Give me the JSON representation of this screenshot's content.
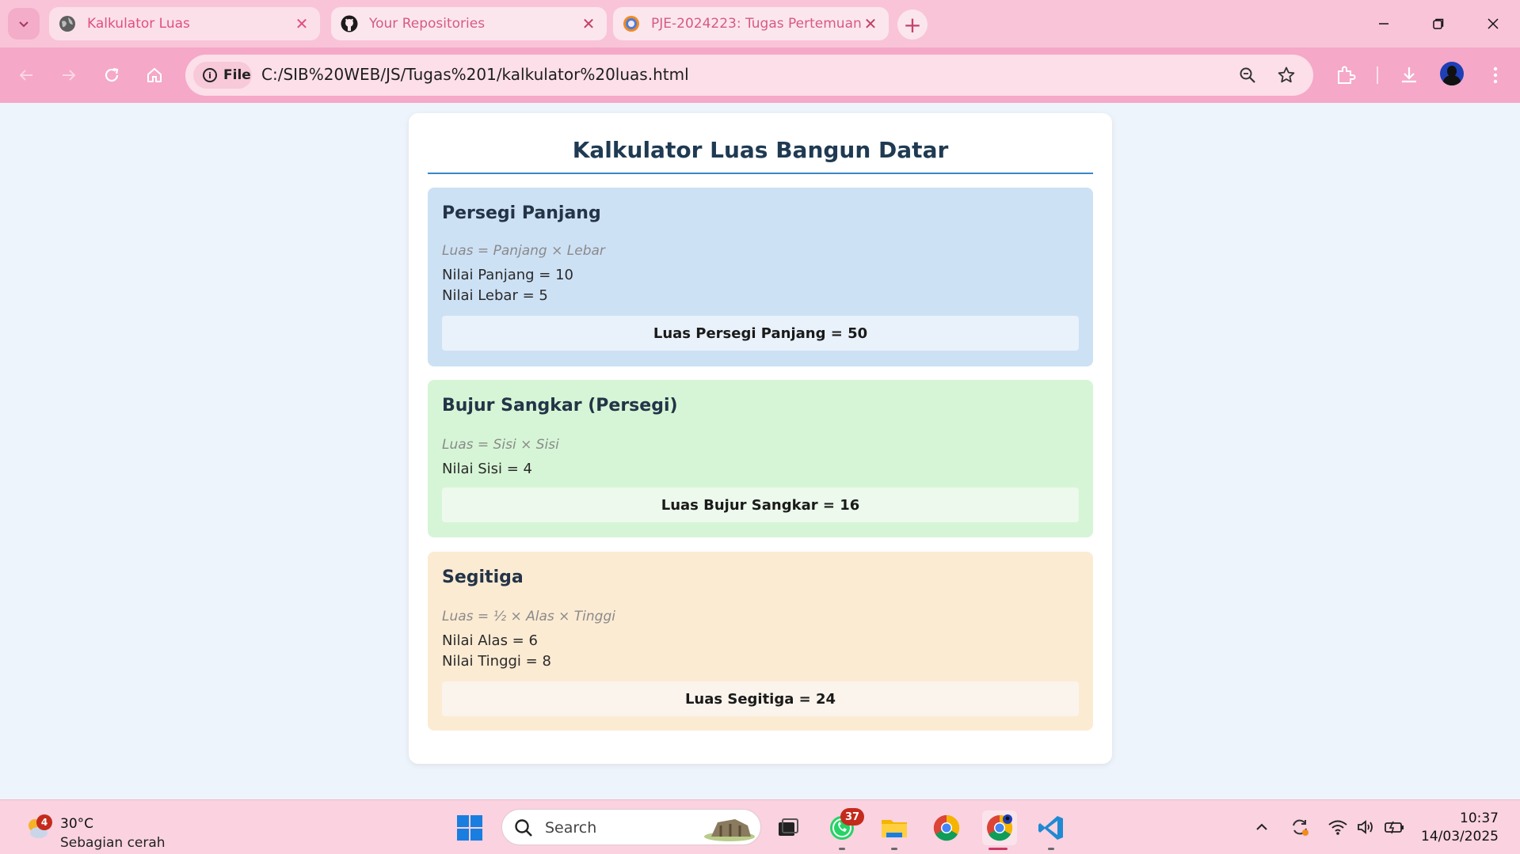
{
  "browser": {
    "tabs": [
      {
        "title": "Kalkulator Luas",
        "active": true,
        "favicon": "globe-icon"
      },
      {
        "title": "Your Repositories",
        "active": false,
        "favicon": "github-icon"
      },
      {
        "title": "PJE-2024223: Tugas Pertemuan",
        "active": false,
        "favicon": "moodle-icon"
      }
    ],
    "site_chip": "File",
    "url": "C:/SIB%20WEB/JS/Tugas%201/kalkulator%20luas.html"
  },
  "page": {
    "title": "Kalkulator Luas Bangun Datar",
    "cards": [
      {
        "heading": "Persegi Panjang",
        "formula": "Luas = Panjang × Lebar",
        "values": [
          "Nilai Panjang = 10",
          "Nilai Lebar = 5"
        ],
        "result": "Luas Persegi Panjang = 50",
        "color": "#cde1f5"
      },
      {
        "heading": "Bujur Sangkar (Persegi)",
        "formula": "Luas = Sisi × Sisi",
        "values": [
          "Nilai Sisi = 4"
        ],
        "result": "Luas Bujur Sangkar = 16",
        "color": "#d6f5d6"
      },
      {
        "heading": "Segitiga",
        "formula": "Luas = ½ × Alas × Tinggi",
        "values": [
          "Nilai Alas = 6",
          "Nilai Tinggi = 8"
        ],
        "result": "Luas Segitiga = 24",
        "color": "#fcebd3"
      }
    ]
  },
  "taskbar": {
    "weather": {
      "temp": "30°C",
      "condition": "Sebagian cerah",
      "badge": "4"
    },
    "search_placeholder": "Search",
    "whatsapp_badge": "37",
    "time": "10:37",
    "date": "14/03/2025"
  },
  "colors": {
    "accent": "#e0507e",
    "title_rule": "#3a86c4",
    "chrome_bg": "#f9c4d8"
  }
}
